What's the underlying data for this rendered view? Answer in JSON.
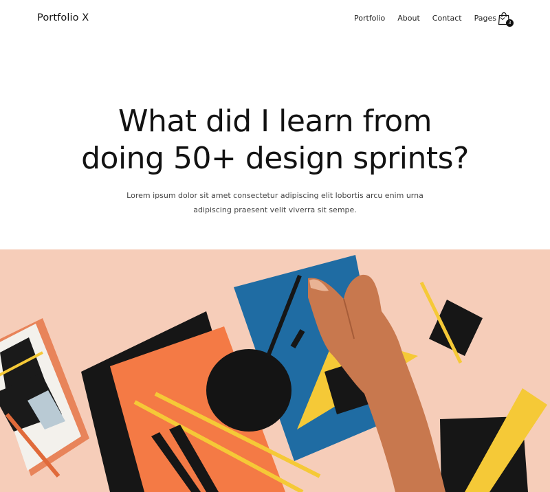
{
  "brand": {
    "name": "Portfolio X"
  },
  "nav": {
    "items": [
      {
        "label": "Portfolio"
      },
      {
        "label": "About"
      },
      {
        "label": "Contact"
      },
      {
        "label": "Pages"
      }
    ],
    "cart_count": "3"
  },
  "hero": {
    "title_line1": "What did I learn from",
    "title_line2": "doing 50+ design sprints?",
    "subtitle_line1": "Lorem ipsum dolor sit amet consectetur adipiscing elit lobortis arcu enim urna",
    "subtitle_line2": "adipiscing praesent velit viverra sit sempe."
  },
  "icons": {
    "pages_dropdown": "chevron-down-icon",
    "cart": "shopping-bag-icon"
  },
  "colors": {
    "background": "#ffffff",
    "text": "#111111",
    "image_background": "#f6cdb9",
    "orange": "#f47a45",
    "blue": "#1f6ca3",
    "yellow": "#f5c937",
    "black": "#111111"
  }
}
